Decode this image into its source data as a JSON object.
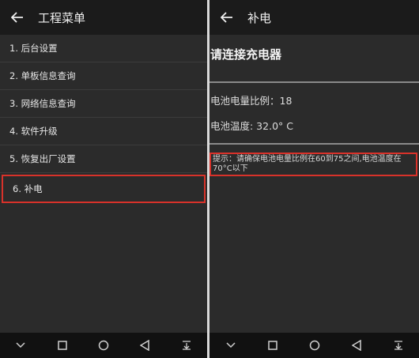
{
  "left": {
    "title": "工程菜单",
    "menu": [
      "1. 后台设置",
      "2. 单板信息查询",
      "3. 网络信息查询",
      "4. 软件升级",
      "5. 恢复出厂设置",
      "6. 补电"
    ]
  },
  "right": {
    "title": "补电",
    "heading": "请连接充电器",
    "battery_ratio": "电池电量比例：18",
    "battery_temp": "电池温度: 32.0° C",
    "tip": "提示：请确保电池电量比例在60到75之间,电池温度在70°C以下"
  },
  "colors": {
    "highlight": "#d8322a",
    "background": "#2b2b2b",
    "appbar": "#1b1b1b"
  }
}
